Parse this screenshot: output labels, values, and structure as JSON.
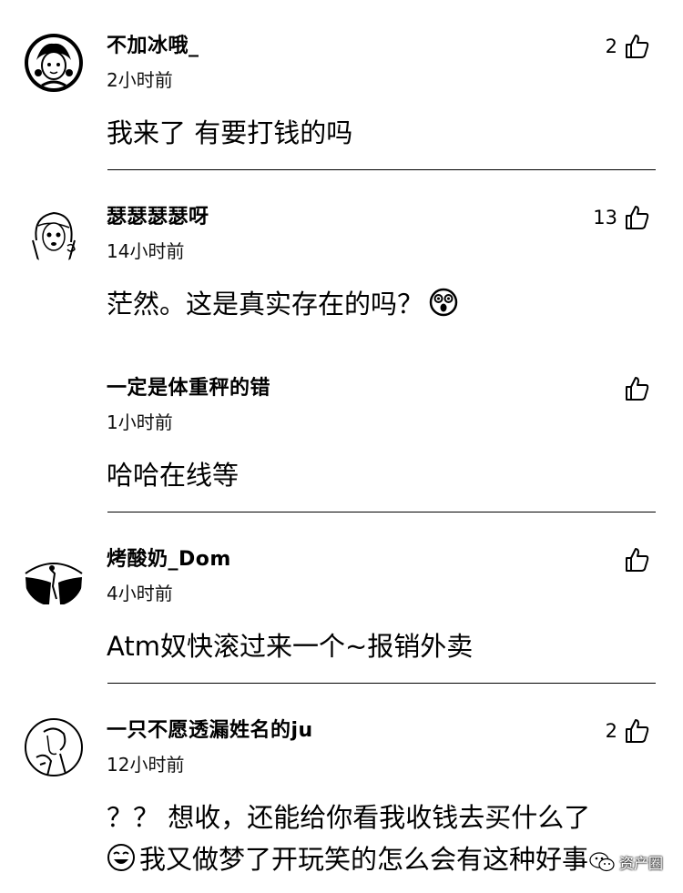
{
  "comments": [
    {
      "user": "不加冰哦_",
      "time": "2小时前",
      "text": "我来了 有要打钱的吗",
      "likes": "2",
      "avatar_icon": "cartoon-girl-avatar-icon"
    },
    {
      "user": "瑟瑟瑟瑟呀",
      "time": "14小时前",
      "text": "茫然。这是真实存在的吗？",
      "likes": "13",
      "avatar_icon": "sketch-girl-avatar-icon",
      "emoji": "shocked-face-emoji-icon",
      "reply": {
        "user": "一定是体重秤的错",
        "time": "1小时前",
        "text": "哈哈在线等",
        "likes": ""
      }
    },
    {
      "user": "烤酸奶_Dom",
      "time": "4小时前",
      "text": "Atm奴快滚过来一个~报销外卖",
      "likes": "",
      "avatar_icon": "silhouette-figure-avatar-icon"
    },
    {
      "user": "一只不愿透漏姓名的ju",
      "time": "12小时前",
      "text": "？？ 想收，还能给你看我收钱去买什么了",
      "text2": "我又做梦了开玩笑的怎么会有这种好事",
      "likes": "2",
      "avatar_icon": "line-drawing-avatar-icon"
    }
  ],
  "watermark": "资产圈",
  "colors": {
    "text": "#000000",
    "background": "#ffffff"
  }
}
